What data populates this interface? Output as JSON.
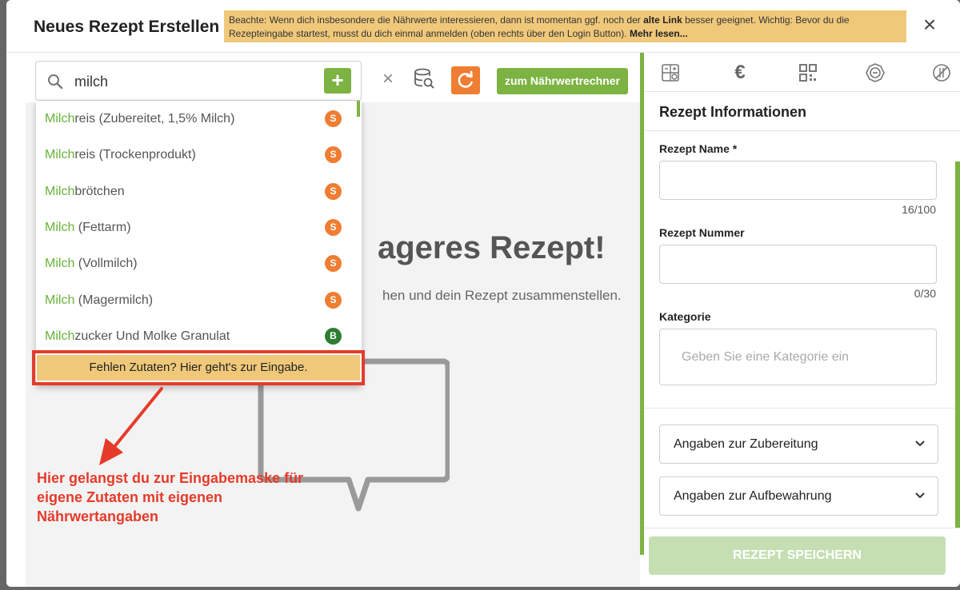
{
  "modal": {
    "title": "Neues Rezept Erstellen",
    "notice": {
      "text1": "Beachte: Wenn dich insbesondere die Nährwerte interessieren, dann ist momentan ggf. noch der",
      "link1": "alte Link",
      "text2": "besser geeignet. Wichtig: Bevor du die Rezepteingabe startest, musst du dich einmal anmelden (oben rechts über den Login Button).",
      "link2": "Mehr lesen..."
    },
    "close_symbol": "×"
  },
  "search": {
    "value": "milch",
    "add_symbol": "+"
  },
  "toolbar": {
    "clear_symbol": "×",
    "calculator_button": "zum Nährwertrechner"
  },
  "empty_state": {
    "title": "ageres Rezept!",
    "subtitle": "hen und dein Rezept zusammenstellen."
  },
  "dropdown": {
    "items": [
      {
        "match": "Milch",
        "rest": "reis (Zubereitet, 1,5% Milch)",
        "badge": "S"
      },
      {
        "match": "Milch",
        "rest": "reis (Trockenprodukt)",
        "badge": "S"
      },
      {
        "match": "Milch",
        "rest": "brötchen",
        "badge": "S"
      },
      {
        "match": "Milch",
        "rest": " (Fettarm)",
        "badge": "S"
      },
      {
        "match": "Milch",
        "rest": " (Vollmilch)",
        "badge": "S"
      },
      {
        "match": "Milch",
        "rest": " (Magermilch)",
        "badge": "S"
      },
      {
        "match": "Milch",
        "rest": "zucker Und Molke Granulat",
        "badge": "B"
      }
    ],
    "missing_button": "Fehlen Zutaten? Hier geht's zur Eingabe."
  },
  "annotation": {
    "text": "Hier gelangst du zur Eingabemaske für eigene Zutaten mit eigenen Nährwertangaben",
    "color": "#e63b2a"
  },
  "right_panel": {
    "tab_icons": [
      "calculator-icon",
      "euro-icon",
      "qr-code-icon",
      "settings-icon",
      "no-allergen-icon"
    ],
    "euro_symbol": "€",
    "section_title": "Rezept Informationen",
    "name_label": "Rezept Name *",
    "name_count": "16/100",
    "number_label": "Rezept Nummer",
    "number_count": "0/30",
    "category_label": "Kategorie",
    "category_placeholder": "Geben Sie eine Kategorie ein",
    "accordion_preparation": "Angaben zur Zubereitung",
    "accordion_storage": "Angaben zur Aufbewahrung",
    "save_button": "REZEPT SPEICHERN"
  },
  "colors": {
    "accent_green": "#7cb342",
    "accent_orange": "#ef7d32",
    "notice_yellow": "#f0c87a",
    "annotation_red": "#e63b2a"
  }
}
